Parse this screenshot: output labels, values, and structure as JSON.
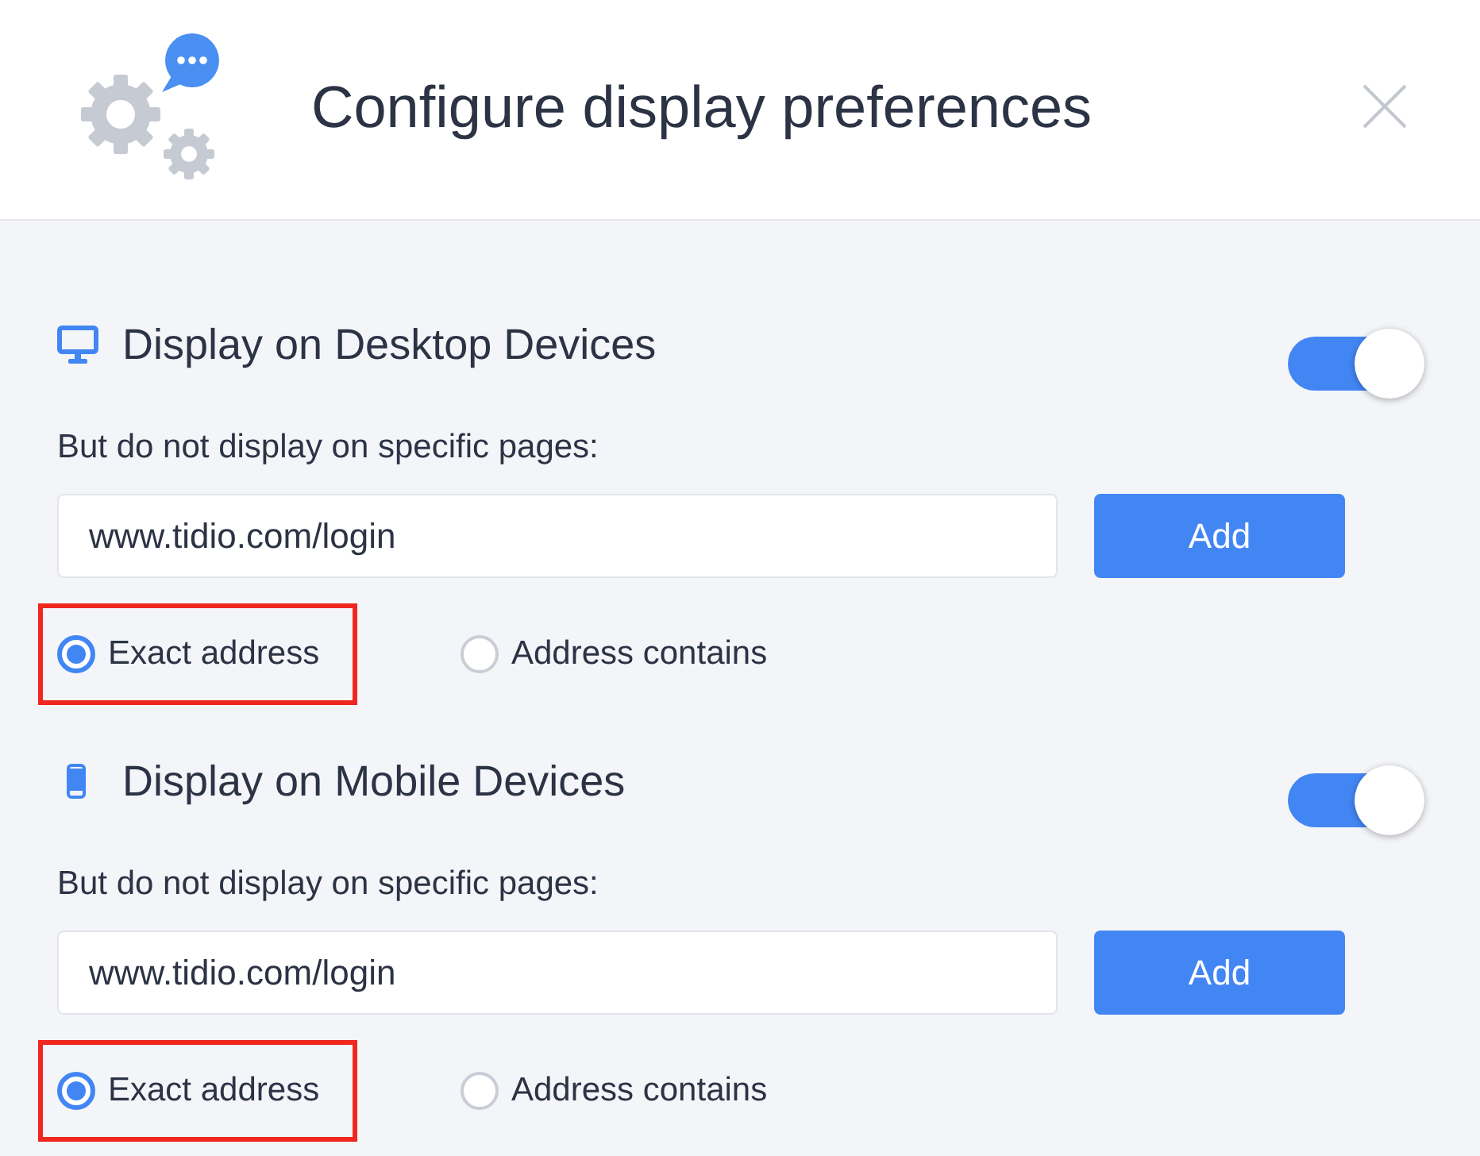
{
  "dialog": {
    "title": "Configure display preferences"
  },
  "sections": [
    {
      "kind": "desktop",
      "title": "Display on Desktop Devices",
      "enabled": true,
      "exclude_label": "But do not display on specific pages:",
      "url_field": {
        "value": "www.tidio.com/login"
      },
      "add_button": "Add",
      "match_options": [
        {
          "label": "Exact address",
          "selected": true,
          "highlighted": true
        },
        {
          "label": "Address contains",
          "selected": false,
          "highlighted": false
        }
      ]
    },
    {
      "kind": "mobile",
      "title": "Display on Mobile Devices",
      "enabled": true,
      "exclude_label": "But do not display on specific pages:",
      "url_field": {
        "value": "www.tidio.com/login"
      },
      "add_button": "Add",
      "match_options": [
        {
          "label": "Exact address",
          "selected": true,
          "highlighted": true
        },
        {
          "label": "Address contains",
          "selected": false,
          "highlighted": false
        }
      ]
    }
  ]
}
